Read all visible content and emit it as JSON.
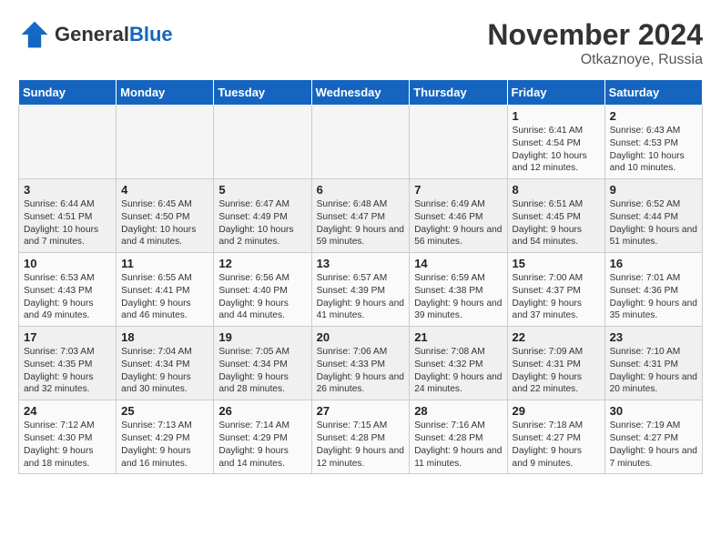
{
  "logo": {
    "general": "General",
    "blue": "Blue"
  },
  "title": "November 2024",
  "location": "Otkaznoye, Russia",
  "days_of_week": [
    "Sunday",
    "Monday",
    "Tuesday",
    "Wednesday",
    "Thursday",
    "Friday",
    "Saturday"
  ],
  "weeks": [
    [
      {
        "day": "",
        "info": ""
      },
      {
        "day": "",
        "info": ""
      },
      {
        "day": "",
        "info": ""
      },
      {
        "day": "",
        "info": ""
      },
      {
        "day": "",
        "info": ""
      },
      {
        "day": "1",
        "info": "Sunrise: 6:41 AM\nSunset: 4:54 PM\nDaylight: 10 hours and 12 minutes."
      },
      {
        "day": "2",
        "info": "Sunrise: 6:43 AM\nSunset: 4:53 PM\nDaylight: 10 hours and 10 minutes."
      }
    ],
    [
      {
        "day": "3",
        "info": "Sunrise: 6:44 AM\nSunset: 4:51 PM\nDaylight: 10 hours and 7 minutes."
      },
      {
        "day": "4",
        "info": "Sunrise: 6:45 AM\nSunset: 4:50 PM\nDaylight: 10 hours and 4 minutes."
      },
      {
        "day": "5",
        "info": "Sunrise: 6:47 AM\nSunset: 4:49 PM\nDaylight: 10 hours and 2 minutes."
      },
      {
        "day": "6",
        "info": "Sunrise: 6:48 AM\nSunset: 4:47 PM\nDaylight: 9 hours and 59 minutes."
      },
      {
        "day": "7",
        "info": "Sunrise: 6:49 AM\nSunset: 4:46 PM\nDaylight: 9 hours and 56 minutes."
      },
      {
        "day": "8",
        "info": "Sunrise: 6:51 AM\nSunset: 4:45 PM\nDaylight: 9 hours and 54 minutes."
      },
      {
        "day": "9",
        "info": "Sunrise: 6:52 AM\nSunset: 4:44 PM\nDaylight: 9 hours and 51 minutes."
      }
    ],
    [
      {
        "day": "10",
        "info": "Sunrise: 6:53 AM\nSunset: 4:43 PM\nDaylight: 9 hours and 49 minutes."
      },
      {
        "day": "11",
        "info": "Sunrise: 6:55 AM\nSunset: 4:41 PM\nDaylight: 9 hours and 46 minutes."
      },
      {
        "day": "12",
        "info": "Sunrise: 6:56 AM\nSunset: 4:40 PM\nDaylight: 9 hours and 44 minutes."
      },
      {
        "day": "13",
        "info": "Sunrise: 6:57 AM\nSunset: 4:39 PM\nDaylight: 9 hours and 41 minutes."
      },
      {
        "day": "14",
        "info": "Sunrise: 6:59 AM\nSunset: 4:38 PM\nDaylight: 9 hours and 39 minutes."
      },
      {
        "day": "15",
        "info": "Sunrise: 7:00 AM\nSunset: 4:37 PM\nDaylight: 9 hours and 37 minutes."
      },
      {
        "day": "16",
        "info": "Sunrise: 7:01 AM\nSunset: 4:36 PM\nDaylight: 9 hours and 35 minutes."
      }
    ],
    [
      {
        "day": "17",
        "info": "Sunrise: 7:03 AM\nSunset: 4:35 PM\nDaylight: 9 hours and 32 minutes."
      },
      {
        "day": "18",
        "info": "Sunrise: 7:04 AM\nSunset: 4:34 PM\nDaylight: 9 hours and 30 minutes."
      },
      {
        "day": "19",
        "info": "Sunrise: 7:05 AM\nSunset: 4:34 PM\nDaylight: 9 hours and 28 minutes."
      },
      {
        "day": "20",
        "info": "Sunrise: 7:06 AM\nSunset: 4:33 PM\nDaylight: 9 hours and 26 minutes."
      },
      {
        "day": "21",
        "info": "Sunrise: 7:08 AM\nSunset: 4:32 PM\nDaylight: 9 hours and 24 minutes."
      },
      {
        "day": "22",
        "info": "Sunrise: 7:09 AM\nSunset: 4:31 PM\nDaylight: 9 hours and 22 minutes."
      },
      {
        "day": "23",
        "info": "Sunrise: 7:10 AM\nSunset: 4:31 PM\nDaylight: 9 hours and 20 minutes."
      }
    ],
    [
      {
        "day": "24",
        "info": "Sunrise: 7:12 AM\nSunset: 4:30 PM\nDaylight: 9 hours and 18 minutes."
      },
      {
        "day": "25",
        "info": "Sunrise: 7:13 AM\nSunset: 4:29 PM\nDaylight: 9 hours and 16 minutes."
      },
      {
        "day": "26",
        "info": "Sunrise: 7:14 AM\nSunset: 4:29 PM\nDaylight: 9 hours and 14 minutes."
      },
      {
        "day": "27",
        "info": "Sunrise: 7:15 AM\nSunset: 4:28 PM\nDaylight: 9 hours and 12 minutes."
      },
      {
        "day": "28",
        "info": "Sunrise: 7:16 AM\nSunset: 4:28 PM\nDaylight: 9 hours and 11 minutes."
      },
      {
        "day": "29",
        "info": "Sunrise: 7:18 AM\nSunset: 4:27 PM\nDaylight: 9 hours and 9 minutes."
      },
      {
        "day": "30",
        "info": "Sunrise: 7:19 AM\nSunset: 4:27 PM\nDaylight: 9 hours and 7 minutes."
      }
    ]
  ]
}
